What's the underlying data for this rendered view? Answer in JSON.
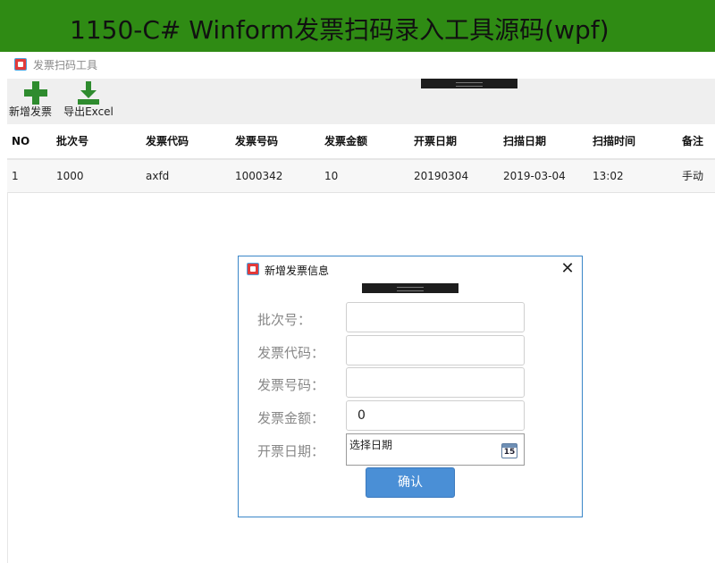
{
  "banner": {
    "text": "1150-C# Winform发票扫码录入工具源码(wpf)"
  },
  "window": {
    "title": "发票扫码工具"
  },
  "toolbar": {
    "add_label": "新增发票",
    "export_label": "导出Excel",
    "icons": {
      "add": "plus-icon",
      "export": "download-icon"
    },
    "accent": "#2e8b2e"
  },
  "table": {
    "headers": [
      "NO",
      "批次号",
      "发票代码",
      "发票号码",
      "发票金额",
      "开票日期",
      "扫描日期",
      "扫描时间",
      "备注"
    ],
    "rows": [
      [
        "1",
        "1000",
        "axfd",
        "1000342",
        "10",
        "20190304",
        "2019-03-04",
        "13:02",
        "手动"
      ]
    ]
  },
  "dialog": {
    "title": "新增发票信息",
    "fields": [
      {
        "label": "批次号：",
        "value": ""
      },
      {
        "label": "发票代码：",
        "value": ""
      },
      {
        "label": "发票号码：",
        "value": ""
      },
      {
        "label": "发票金额：",
        "value": "0"
      },
      {
        "label": "开票日期：",
        "placeholder": "选择日期"
      }
    ],
    "calendar_day": "15",
    "confirm_label": "确认",
    "close_glyph": "✕",
    "accent": "#4a8fd6"
  }
}
